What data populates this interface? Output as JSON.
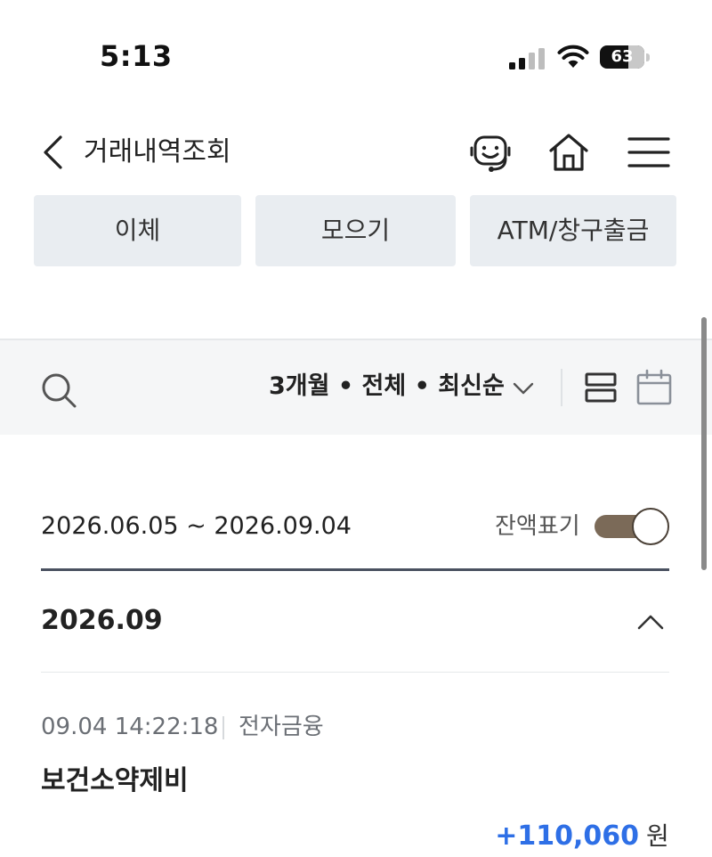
{
  "status_bar": {
    "time": "5:13",
    "battery": "63",
    "battery_level": 0.63,
    "icons": [
      "signal-icon",
      "wifi-icon",
      "battery-icon"
    ]
  },
  "header": {
    "title": "거래내역조회",
    "icons": [
      "back-icon",
      "chatbot-icon",
      "home-icon",
      "menu-icon"
    ]
  },
  "quick_buttons": [
    {
      "label": "이체"
    },
    {
      "label": "모으기"
    },
    {
      "label": "ATM/창구출금"
    }
  ],
  "filter": {
    "summary": "3개월 • 전체 • 최신순",
    "icons": [
      "search-icon",
      "chevron-down-icon",
      "list-view-icon",
      "calendar-icon"
    ]
  },
  "date_range": {
    "text": "2026.06.05 ~ 2026.09.04",
    "balance_toggle_label": "잔액표기",
    "balance_toggle_on": true
  },
  "month": {
    "label": "2026.09",
    "expanded": true
  },
  "transactions": [
    {
      "datetime": "09.04 14:22:18",
      "type": "전자금융",
      "name": "보건소약제비",
      "amount": "+110,060",
      "unit": "원"
    }
  ],
  "colors": {
    "button_bg": "#e9edf1",
    "filter_bar_bg": "#f5f6f7",
    "toggle_on": "#7b6a58",
    "amount_positive": "#2e6fe6"
  }
}
